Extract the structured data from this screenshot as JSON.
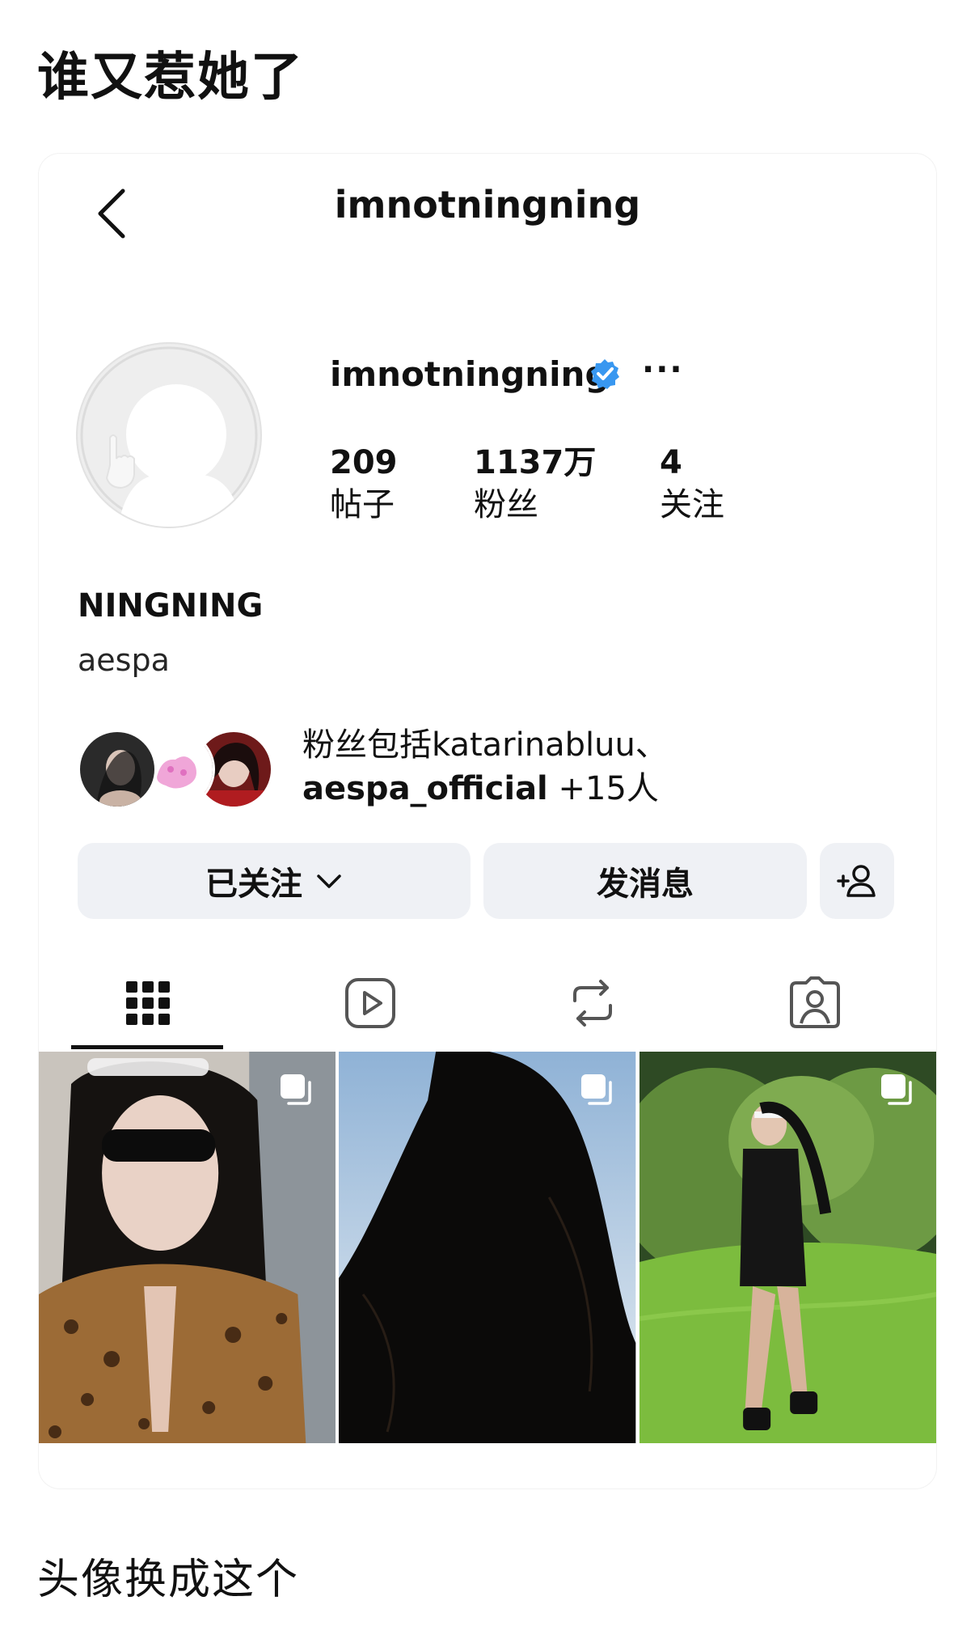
{
  "post": {
    "heading": "谁又惹她了",
    "caption": "头像换成这个"
  },
  "topbar": {
    "title": "imnotningning"
  },
  "profile": {
    "username": "imnotningning",
    "stats": [
      {
        "value": "209",
        "label": "帖子"
      },
      {
        "value": "1137万",
        "label": "粉丝"
      },
      {
        "value": "4",
        "label": "关注"
      }
    ],
    "full_name": "NINGNING",
    "bio": "aespa",
    "mutual": {
      "line1": "粉丝包括katarinabluu、",
      "line2_accent": "aespa_official",
      "line2_rest": " +15人"
    }
  },
  "actions": {
    "following_label": "已关注",
    "message_label": "发消息"
  },
  "colors": {
    "verified": "#3897f0",
    "button_bg": "#eff1f5",
    "text": "#111111"
  },
  "icons": {
    "back": "chevron-left-icon",
    "verified": "verified-badge-icon",
    "more": "more-horizontal-icon",
    "dropdown": "chevron-down-icon",
    "add_person": "add-person-icon",
    "tabs": [
      "grid-icon",
      "reels-icon",
      "reposts-icon",
      "tagged-icon"
    ],
    "carousel": "carousel-icon"
  }
}
